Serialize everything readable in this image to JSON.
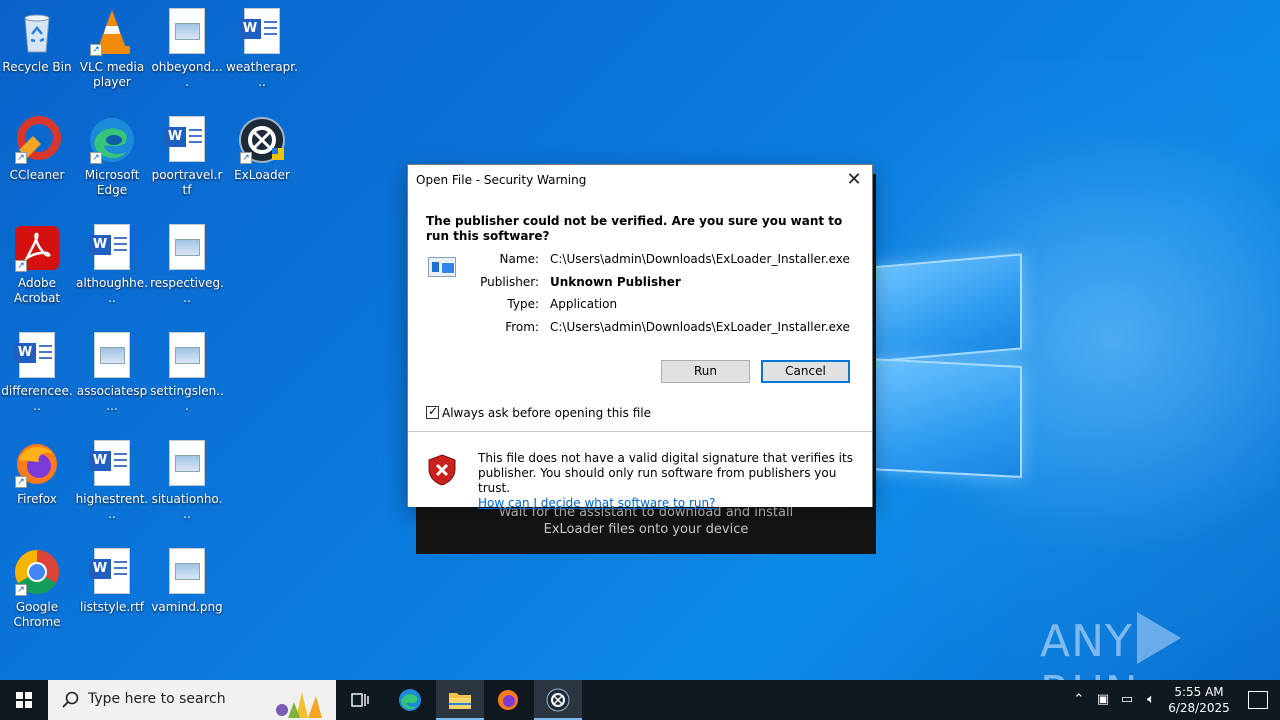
{
  "desktop": {
    "icons": [
      {
        "label": "Recycle Bin"
      },
      {
        "label": "VLC media player"
      },
      {
        "label": "ohbeyond...."
      },
      {
        "label": "weatherapr..."
      },
      {
        "label": "CCleaner"
      },
      {
        "label": "Microsoft Edge"
      },
      {
        "label": "poortravel.rtf"
      },
      {
        "label": "ExLoader"
      },
      {
        "label": "Adobe Acrobat"
      },
      {
        "label": "althoughhe..."
      },
      {
        "label": "respectiveg..."
      },
      {
        "label": "differencee..."
      },
      {
        "label": "associatesp..."
      },
      {
        "label": "settingslen..."
      },
      {
        "label": "Firefox"
      },
      {
        "label": "highestrent..."
      },
      {
        "label": "situationho..."
      },
      {
        "label": "Google Chrome"
      },
      {
        "label": "liststyle.rtf"
      },
      {
        "label": "vamind.png"
      }
    ]
  },
  "installer": {
    "text_line1": "Wait for the assistant to download and install",
    "text_line2": "ExLoader files onto your device"
  },
  "dialog": {
    "title": "Open File - Security Warning",
    "heading": "The publisher could not be verified.  Are you sure you want to run this software?",
    "fields": {
      "name_label": "Name:",
      "name_value": "C:\\Users\\admin\\Downloads\\ExLoader_Installer.exe",
      "publisher_label": "Publisher:",
      "publisher_value": "Unknown Publisher",
      "type_label": "Type:",
      "type_value": "Application",
      "from_label": "From:",
      "from_value": "C:\\Users\\admin\\Downloads\\ExLoader_Installer.exe"
    },
    "run_label": "Run",
    "cancel_label": "Cancel",
    "checkbox_label": "Always ask before opening this file",
    "checkbox_checked": true,
    "footer_text": "This file does not have a valid digital signature that verifies its publisher.  You should only run software from publishers you trust.",
    "footer_link": "How can I decide what software to run?"
  },
  "watermark": {
    "left": "ANY",
    "right": "RUN"
  },
  "taskbar": {
    "search_placeholder": "Type here to search",
    "time": "5:55 AM",
    "date": "6/28/2025"
  }
}
